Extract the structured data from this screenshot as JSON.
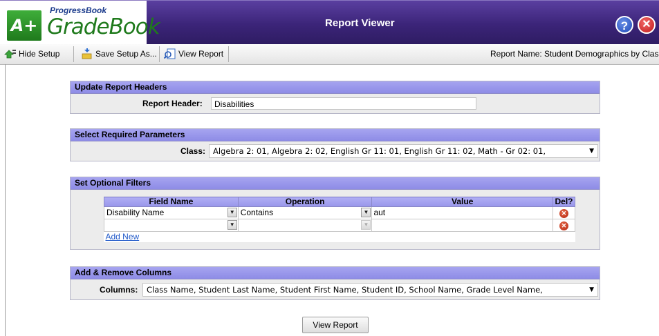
{
  "header": {
    "brand_small": "ProgressBook",
    "brand_big": "GradeBook",
    "logo_text": "A+",
    "title": "Report Viewer",
    "help_glyph": "?",
    "close_glyph": "✕"
  },
  "toolbar": {
    "hide_setup": "Hide Setup",
    "save_setup": "Save Setup As...",
    "view_report": "View Report",
    "report_name": "Report Name: Student Demographics by Class"
  },
  "update_headers": {
    "title": "Update Report Headers",
    "label": "Report Header:",
    "value": "Disabilities"
  },
  "required_params": {
    "title": "Select Required Parameters",
    "label": "Class:",
    "value": "Algebra 2: 01, Algebra 2: 02, English Gr 11: 01, English Gr 11: 02, Math - Gr 02: 01,"
  },
  "optional_filters": {
    "title": "Set Optional Filters",
    "columns": [
      "Field Name",
      "Operation",
      "Value",
      "Del?"
    ],
    "rows": [
      {
        "field": "Disability Name",
        "operation": "Contains",
        "value": "aut"
      },
      {
        "field": "",
        "operation": "",
        "value": ""
      }
    ],
    "add_new": "Add New"
  },
  "columns_panel": {
    "title": "Add & Remove Columns",
    "label": "Columns:",
    "value": "Class Name, Student Last Name, Student First Name, Student ID, School Name, Grade Level Name,"
  },
  "footer": {
    "view_report_button": "View Report"
  },
  "colors": {
    "header_bg": "#3b2478",
    "panel_head": "#9896ea",
    "link": "#1f58c8"
  }
}
